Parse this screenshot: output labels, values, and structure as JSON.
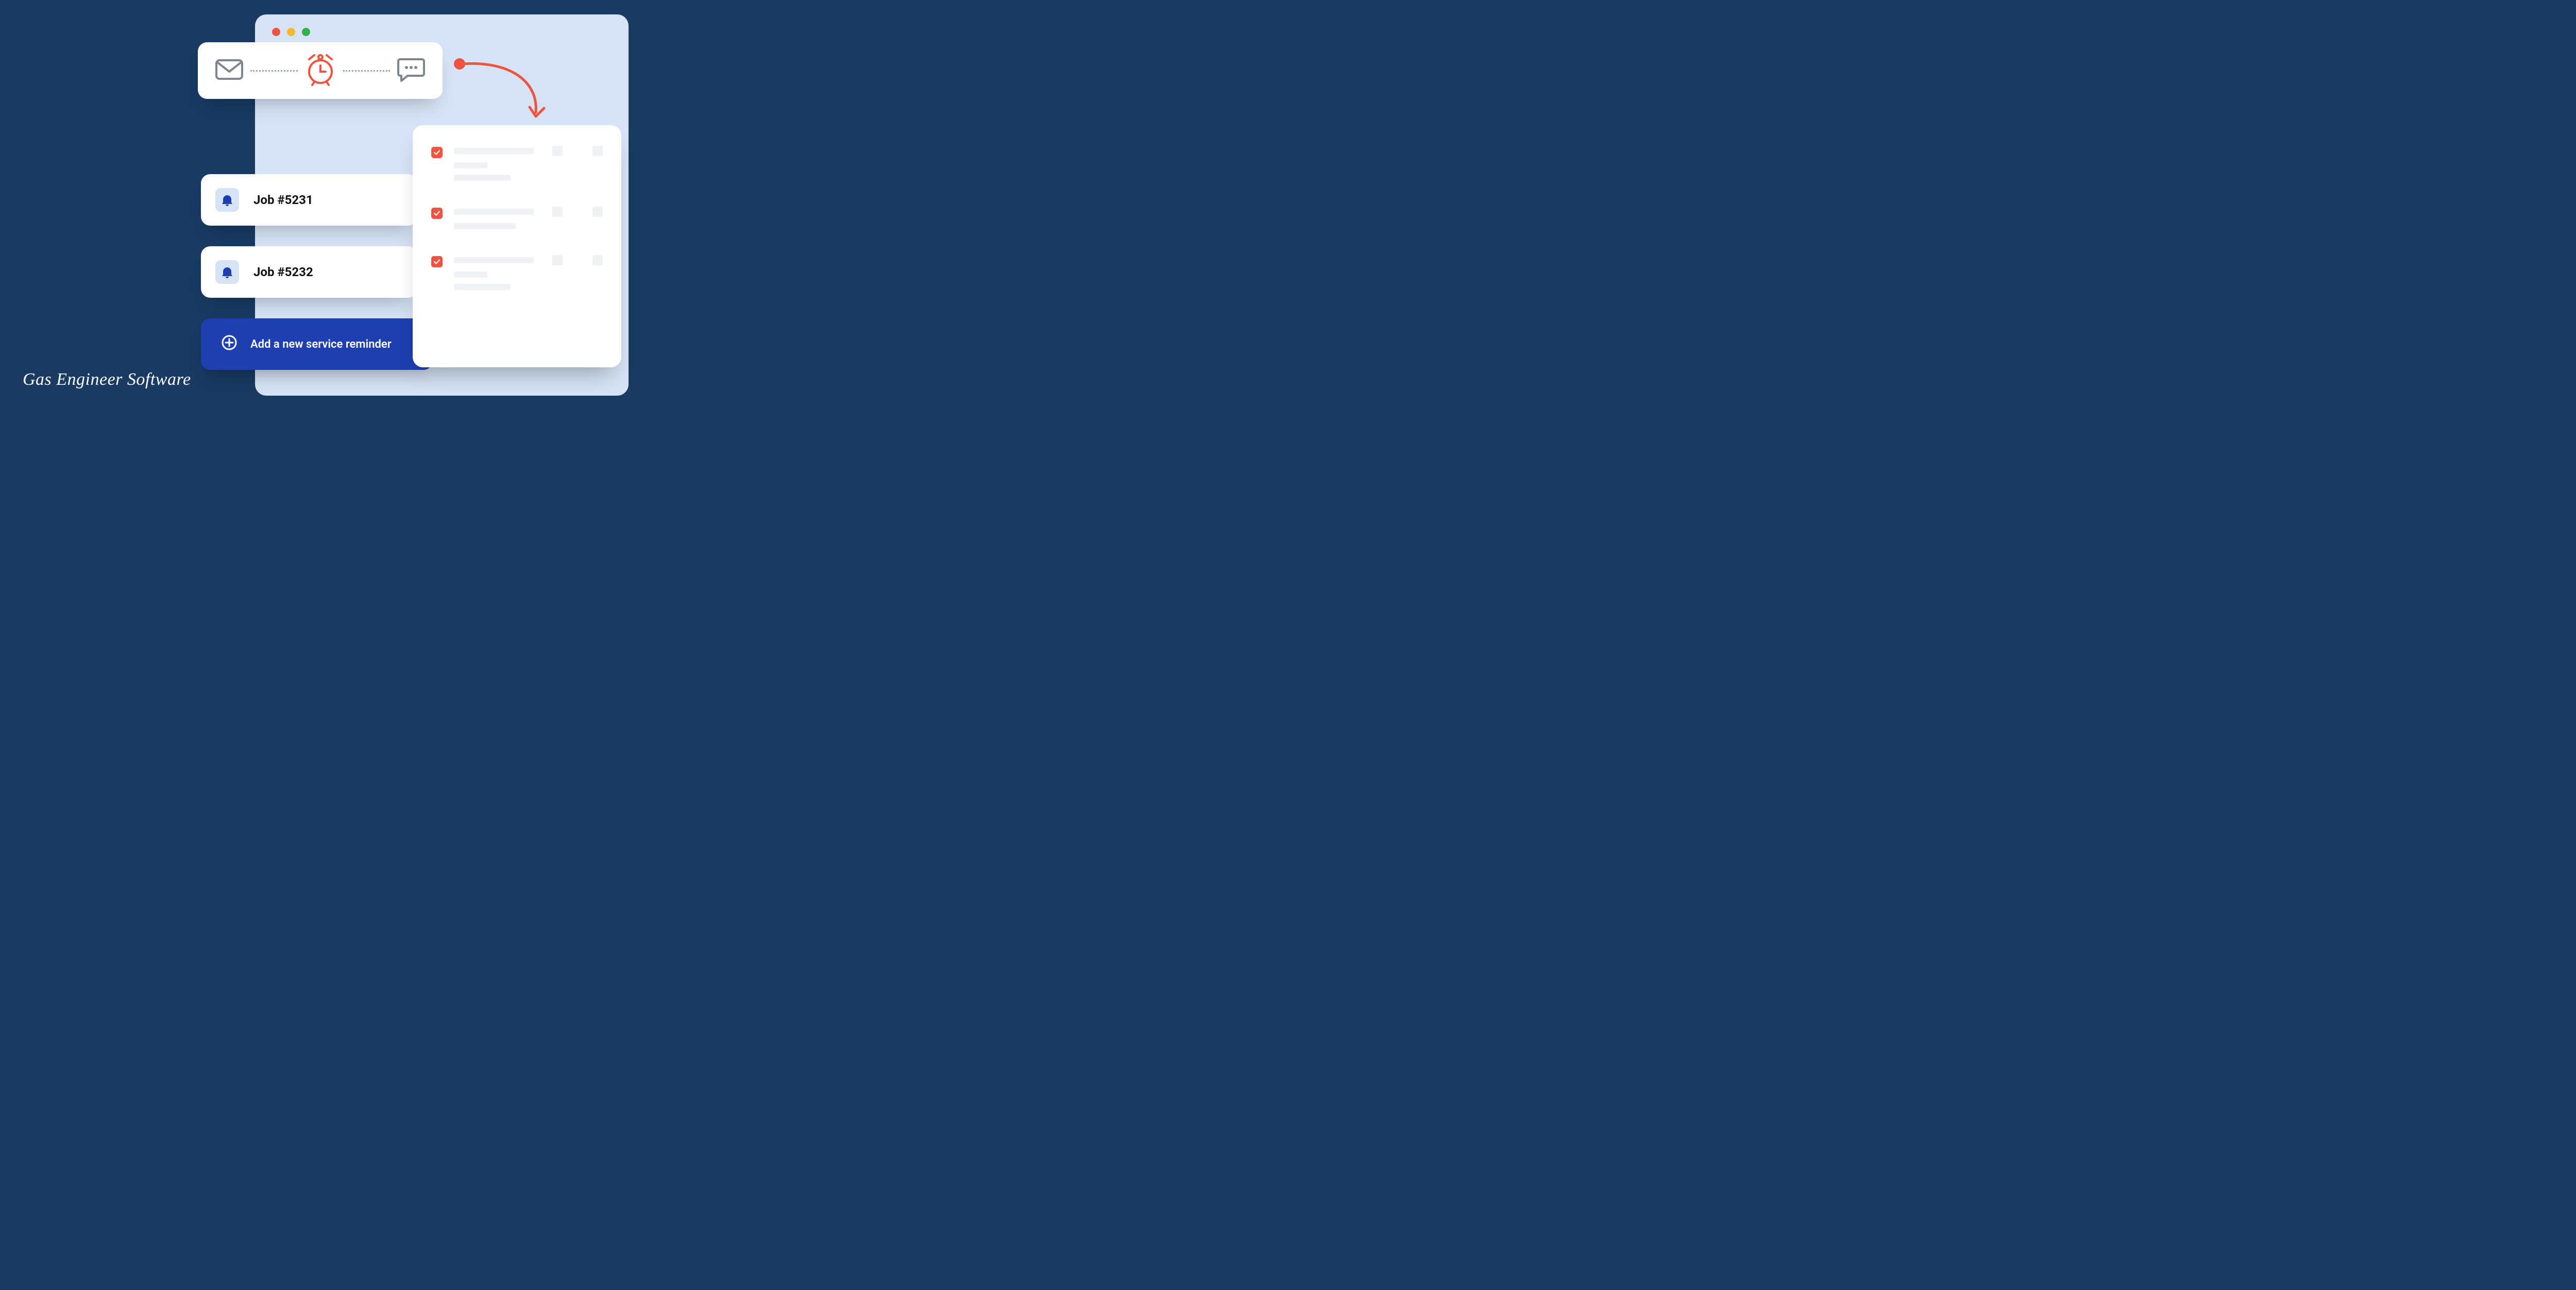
{
  "brand": "Gas Engineer Software",
  "jobs": [
    {
      "label": "Job #5231"
    },
    {
      "label": "Job #5232"
    }
  ],
  "add_button": {
    "label": "Add a new service reminder"
  },
  "colors": {
    "accent_orange": "#f05340",
    "primary_blue": "#1d3fb0",
    "panel_blue": "#d6e3f5",
    "bg_navy": "#183a63"
  },
  "checklist": {
    "items_checked": [
      true,
      true,
      true
    ]
  }
}
